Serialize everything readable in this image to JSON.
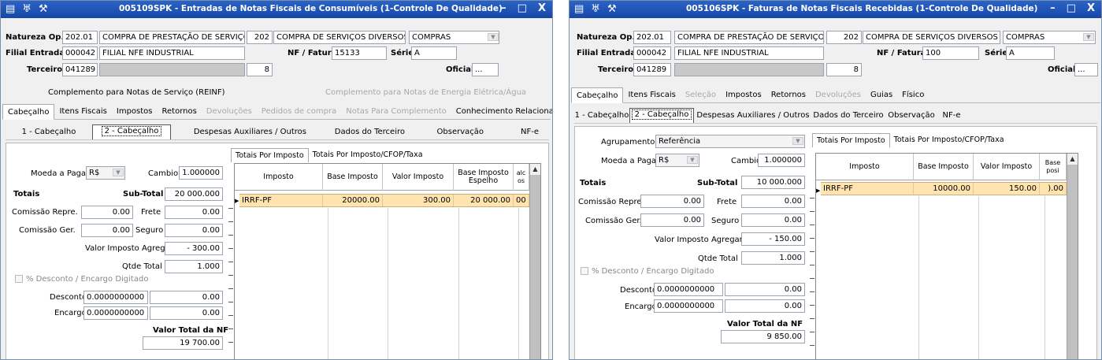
{
  "left": {
    "title": "005109SPK - Entradas de Notas Fiscais de Consumíveis (1-Controle De Qualidade)",
    "header": {
      "natureza_label": "Natureza Op.",
      "natureza_code": "202.01",
      "natureza_desc": "COMPRA DE PRESTAÇÃO DE SERVIÇOS",
      "natureza_num": "202",
      "natureza_desc2": "COMPRA DE SERVIÇOS DIVERSOS",
      "natureza_tipo": "COMPRAS",
      "filial_label": "Filial Entrada",
      "filial_code": "000042",
      "filial_desc": "FILIAL NFE INDUSTRIAL",
      "nf_label": "NF / Fatura",
      "nf_value": "15133",
      "serie_label": "Série",
      "serie_value": "A",
      "terceiro_label": "Terceiro",
      "terceiro_code": "041289",
      "terceiro_num": "8",
      "oficial_label": "Oficial",
      "oficial_btn": "..."
    },
    "complement_tabs": [
      "Complemento para Notas de Serviço (REINF)",
      "Complemento para Notas de Energia Elétrica/Água"
    ],
    "tabs": [
      "Cabeçalho",
      "Itens Fiscais",
      "Impostos",
      "Retornos",
      "Devoluções",
      "Pedidos de compra",
      "Notas Para Complemento",
      "Conhecimento Relacionado"
    ],
    "subtabs": [
      "1 - Cabeçalho",
      "2 - Cabeçalho",
      "Despesas Auxiliares / Outros",
      "Dados do Terceiro",
      "Observação",
      "NF-e"
    ],
    "form": {
      "moeda_label": "Moeda a Pagar",
      "moeda_value": "R$",
      "cambio_label": "Cambio",
      "cambio_value": "1.000000",
      "totais_label": "Totais",
      "subtotal_label": "Sub-Total",
      "subtotal_value": "20 000.000",
      "comissao_repre_label": "Comissão Repre.",
      "comissao_repre_value": "0.00",
      "frete_label": "Frete",
      "frete_value": "0.00",
      "comissao_ger_label": "Comissão Ger.",
      "comissao_ger_value": "0.00",
      "seguro_label": "Seguro",
      "seguro_value": "0.00",
      "valor_imposto_label": "Valor Imposto Agregar",
      "valor_imposto_value": "- 300.00",
      "qtde_label": "Qtde Total",
      "qtde_value": "1.000",
      "desconto_encargo_label": "% Desconto / Encargo Digitado",
      "desconto_label": "Desconto",
      "desconto_pct": "0.0000000000",
      "desconto_value": "0.00",
      "encargo_label": "Encargo",
      "encargo_pct": "0.0000000000",
      "encargo_value": "0.00",
      "valor_total_label": "Valor Total da NF",
      "valor_total_value": "19 700.00"
    },
    "grid_tabs": [
      "Totais Por Imposto",
      "Totais Por Imposto/CFOP/Taxa"
    ],
    "grid_cols": [
      "Imposto",
      "Base Imposto",
      "Valor Imposto",
      "Base Imposto Espelho",
      "alc\nos"
    ],
    "grid_row": {
      "imposto": "IRRF-PF",
      "base": "20000.00",
      "valor": "300.00",
      "espelho": "20 000.00",
      "extra": "00"
    }
  },
  "right": {
    "title": "005106SPK - Faturas de Notas Fiscais Recebidas (1-Controle De Qualidade)",
    "header": {
      "natureza_label": "Natureza Op.",
      "natureza_code": "202.01",
      "natureza_desc": "COMPRA DE PRESTAÇÃO DE SERVIÇOS",
      "natureza_num": "202",
      "natureza_desc2": "COMPRA DE SERVIÇOS DIVERSOS",
      "natureza_tipo": "COMPRAS",
      "filial_label": "Filial Entrada",
      "filial_code": "000042",
      "filial_desc": "FILIAL NFE INDUSTRIAL",
      "nf_label": "NF / Fatura",
      "nf_value": "100",
      "serie_label": "Série",
      "serie_value": "A",
      "terceiro_label": "Terceiro",
      "terceiro_code": "041289",
      "terceiro_num": "8",
      "oficial_label": "Oficial",
      "oficial_btn": "..."
    },
    "tabs": [
      "Cabeçalho",
      "Itens Fiscais",
      "Seleção",
      "Impostos",
      "Retornos",
      "Devoluções",
      "Guias",
      "Físico"
    ],
    "subtabs": [
      "1 - Cabeçalho",
      "2 - Cabeçalho",
      "Despesas Auxiliares / Outros",
      "Dados do Terceiro",
      "Observação",
      "NF-e"
    ],
    "form": {
      "agrupamento_label": "Agrupamento",
      "agrupamento_value": "Referência",
      "moeda_label": "Moeda a Pagar",
      "moeda_value": "R$",
      "cambio_label": "Cambio",
      "cambio_value": "1.000000",
      "totais_label": "Totais",
      "subtotal_label": "Sub-Total",
      "subtotal_value": "10 000.000",
      "comissao_repre_label": "Comissão Repre.",
      "comissao_repre_value": "0.00",
      "frete_label": "Frete",
      "frete_value": "0.00",
      "comissao_ger_label": "Comissão Ger.",
      "comissao_ger_value": "0.00",
      "seguro_label": "Seguro",
      "seguro_value": "0.00",
      "valor_imposto_label": "Valor Imposto Agregar",
      "valor_imposto_value": "- 150.00",
      "qtde_label": "Qtde Total",
      "qtde_value": "1.000",
      "desconto_encargo_label": "% Desconto / Encargo Digitado",
      "desconto_label": "Desconto",
      "desconto_pct": "0.0000000000",
      "desconto_value": "0.00",
      "encargo_label": "Encargo",
      "encargo_pct": "0.0000000000",
      "encargo_value": "0.00",
      "valor_total_label": "Valor Total da NF",
      "valor_total_value": "9 850.00"
    },
    "grid_tabs": [
      "Totais Por Imposto",
      "Totais Por Imposto/CFOP/Taxa"
    ],
    "grid_cols": [
      "Imposto",
      "Base Imposto",
      "Valor Imposto",
      "Base\nposi"
    ],
    "grid_row": {
      "imposto": "IRRF-PF",
      "base": "10000.00",
      "valor": "150.00",
      "espelho": ").00"
    }
  },
  "icons": {
    "app": "window-icon",
    "tree": "tree-icon",
    "tool": "wrench-icon"
  },
  "window_buttons": {
    "minimize": "–",
    "maximize": "□",
    "close": "X"
  },
  "colors": {
    "titlebar": "#1a4fb0",
    "row_highlight": "#ffe4b0",
    "gray_field": "#c8c8c8"
  }
}
